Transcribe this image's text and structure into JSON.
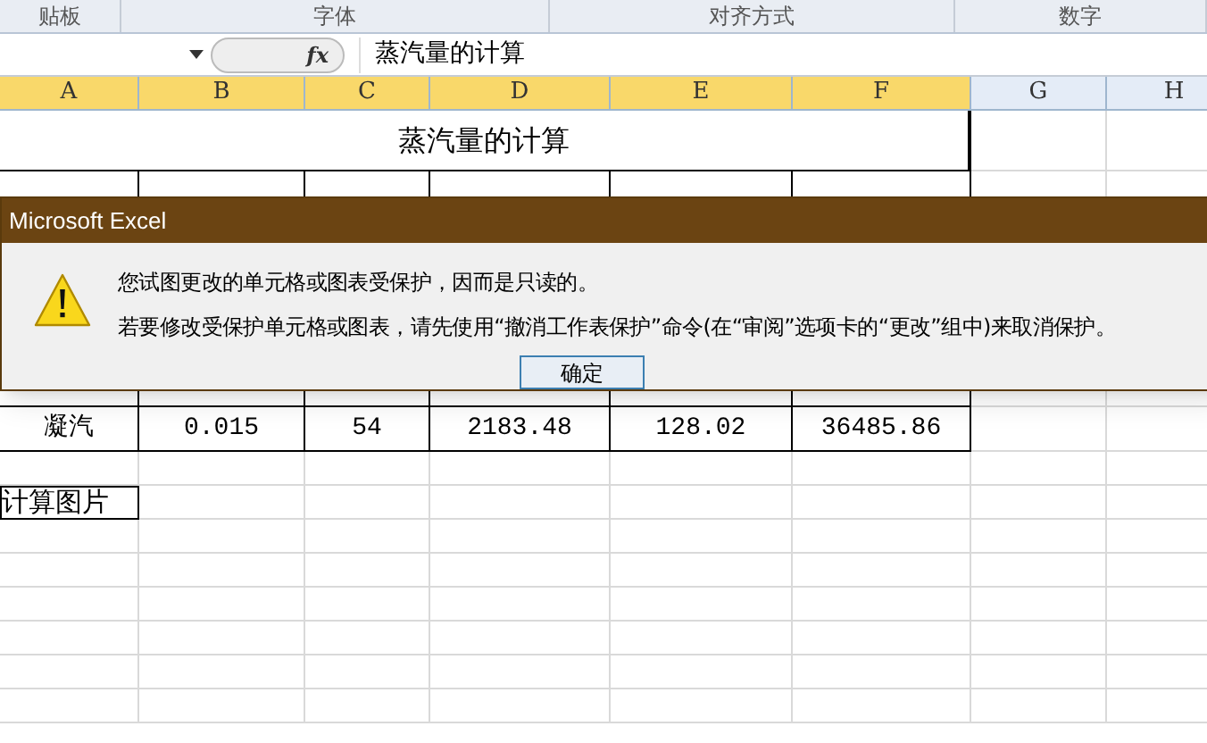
{
  "ribbon_groups": [
    "贴板",
    "字体",
    "对齐方式",
    "数字"
  ],
  "formula_bar": {
    "fx_label": "fx",
    "formula": "蒸汽量的计算"
  },
  "columns": [
    "A",
    "B",
    "C",
    "D",
    "E",
    "F",
    "G",
    "H"
  ],
  "sheet": {
    "title": "蒸汽量的计算",
    "rows": [
      {
        "cells": [
          "凝汽",
          "0.015",
          "54",
          "2183.48",
          "128.02",
          "36485.86"
        ]
      }
    ],
    "note": "计算图片"
  },
  "dialog": {
    "title": "Microsoft Excel",
    "messages": [
      "您试图更改的单元格或图表受保护，因而是只读的。",
      "若要修改受保护单元格或图表，请先使用“撤消工作表保护”命令(在“审阅”选项卡的“更改”组中)来取消保护。"
    ],
    "button": "确定"
  }
}
